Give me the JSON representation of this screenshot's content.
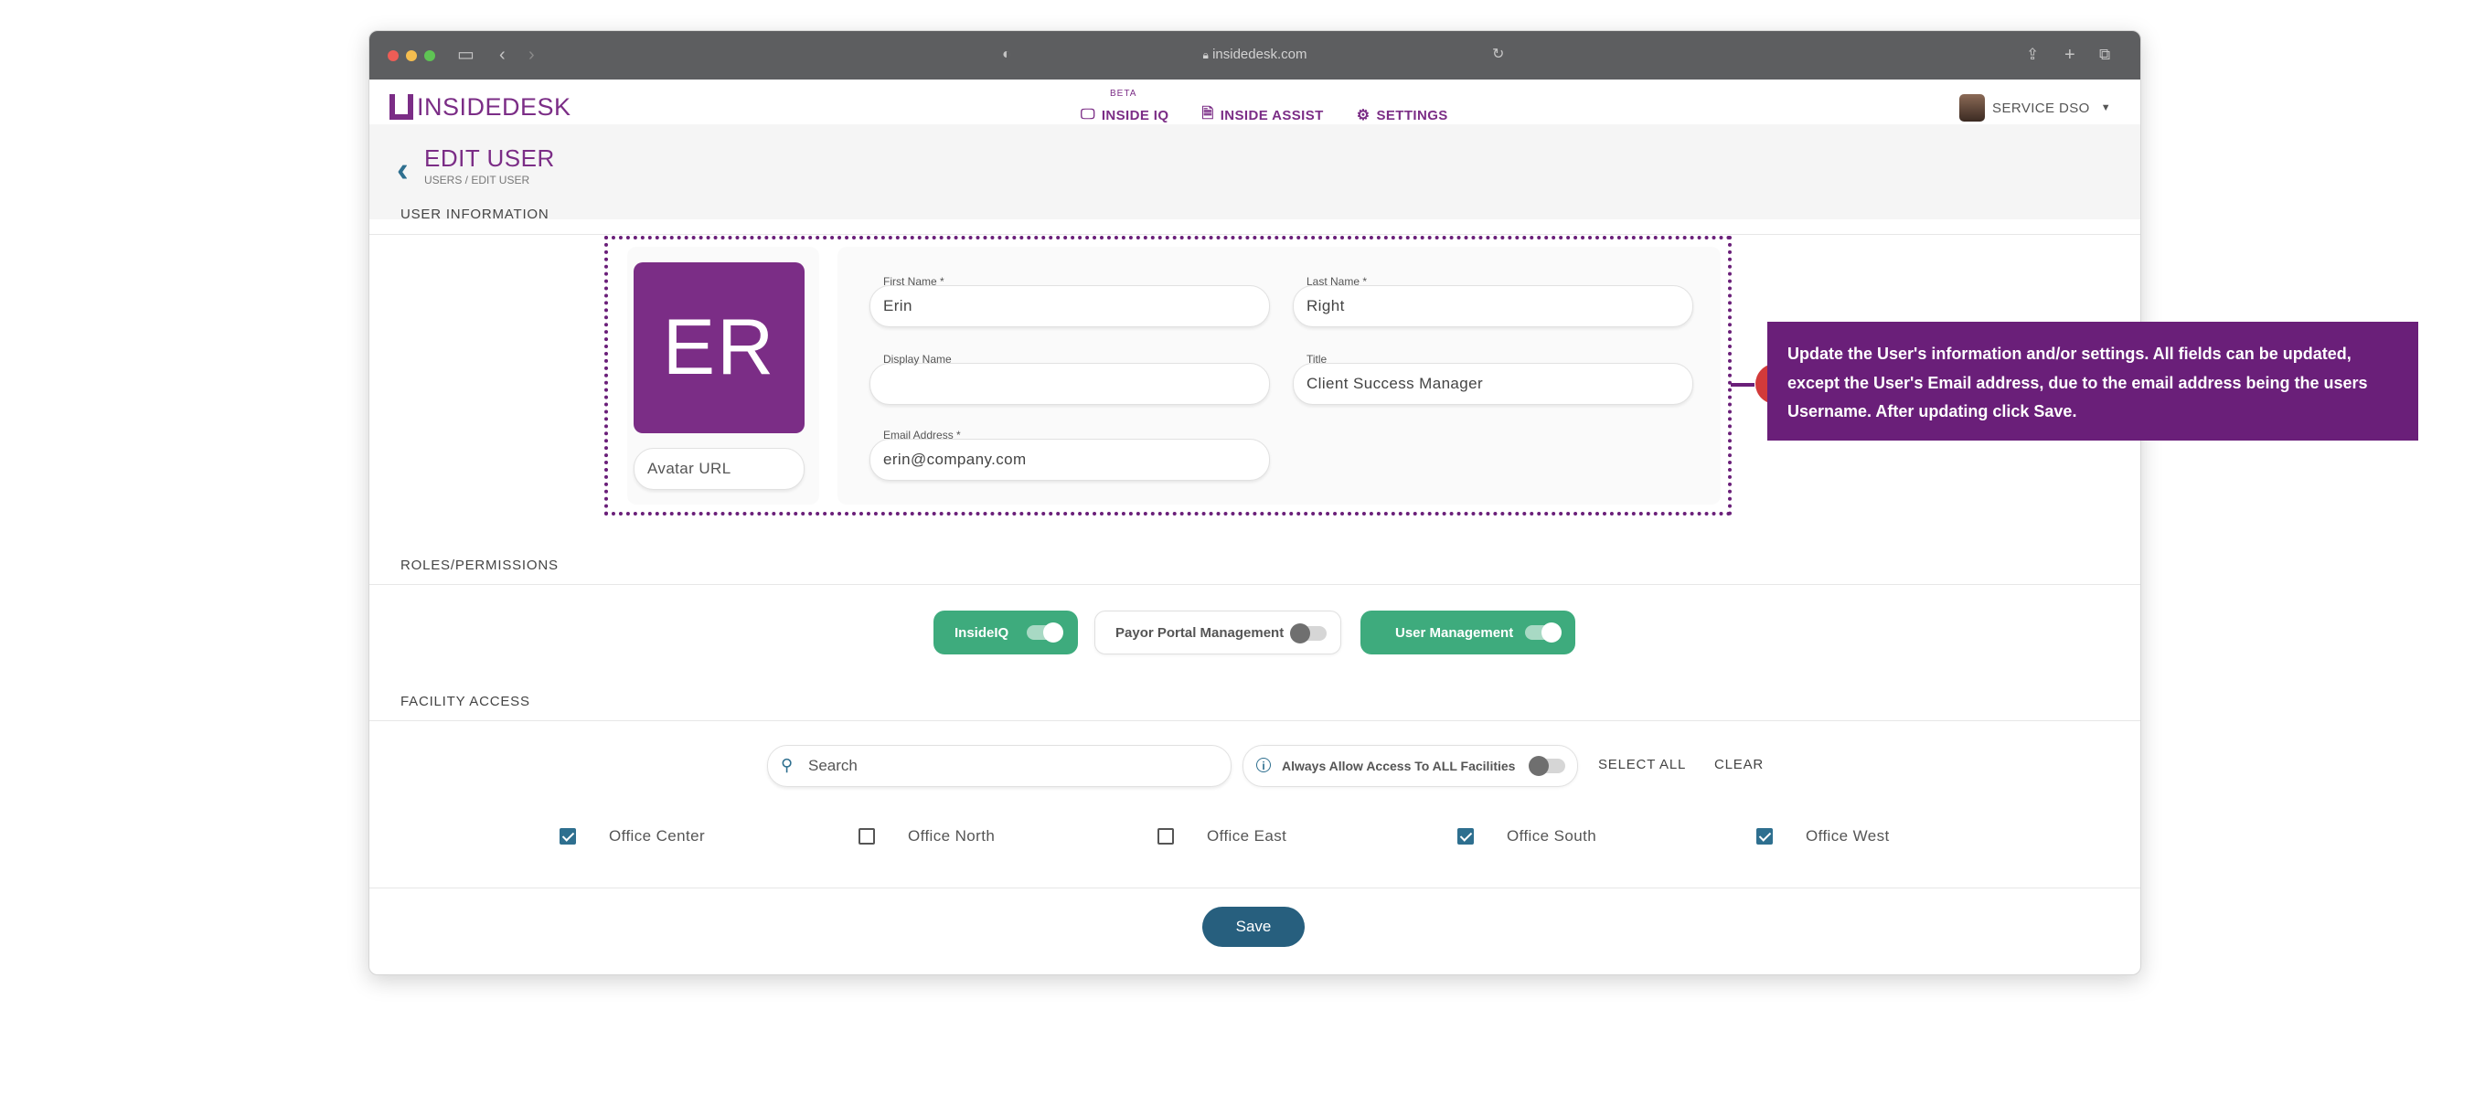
{
  "browser": {
    "url": "insidedesk.com"
  },
  "brand": {
    "inside": "INSIDE",
    "desk": "DESK",
    "color": "#7b2d86"
  },
  "nav": {
    "items": [
      {
        "label": "INSIDE IQ",
        "badge": "BETA",
        "icon": "monitor-icon"
      },
      {
        "label": "INSIDE ASSIST",
        "icon": "document-icon"
      },
      {
        "label": "SETTINGS",
        "icon": "gear-icon",
        "active": true
      }
    ]
  },
  "user_menu": {
    "name": "SERVICE DSO"
  },
  "page": {
    "title": "EDIT USER",
    "breadcrumb": "USERS  / EDIT USER"
  },
  "sections": {
    "user_information": "USER INFORMATION",
    "roles": "ROLES/PERMISSIONS",
    "facility_access": "FACILITY ACCESS"
  },
  "user": {
    "initials": "ER",
    "avatar_url_placeholder": "Avatar URL",
    "fields": {
      "first_name": {
        "label": "First Name *",
        "value": "Erin"
      },
      "last_name": {
        "label": "Last Name *",
        "value": "Right"
      },
      "display_name": {
        "label": "Display Name",
        "value": ""
      },
      "title": {
        "label": "Title",
        "value": "Client Success Manager"
      },
      "email": {
        "label": "Email Address *",
        "value": "erin@company.com"
      }
    }
  },
  "callout": {
    "text": "Update the User's information and/or settings. All fields can be updated, except the User's Email address, due to the email address being the users Username. After updating click Save."
  },
  "roles": [
    {
      "label": "InsideIQ",
      "enabled": true
    },
    {
      "label": "Payor Portal Management",
      "enabled": false
    },
    {
      "label": "User Management",
      "enabled": true
    }
  ],
  "facility_controls": {
    "search_placeholder": "Search",
    "always_allow_label": "Always Allow Access To ALL Facilities",
    "always_allow_enabled": false,
    "select_all": "SELECT ALL",
    "clear": "CLEAR"
  },
  "facilities": [
    {
      "name": "Office Center",
      "checked": true
    },
    {
      "name": "Office North",
      "checked": false
    },
    {
      "name": "Office East",
      "checked": false
    },
    {
      "name": "Office South",
      "checked": true
    },
    {
      "name": "Office West",
      "checked": true
    }
  ],
  "actions": {
    "save": "Save"
  }
}
